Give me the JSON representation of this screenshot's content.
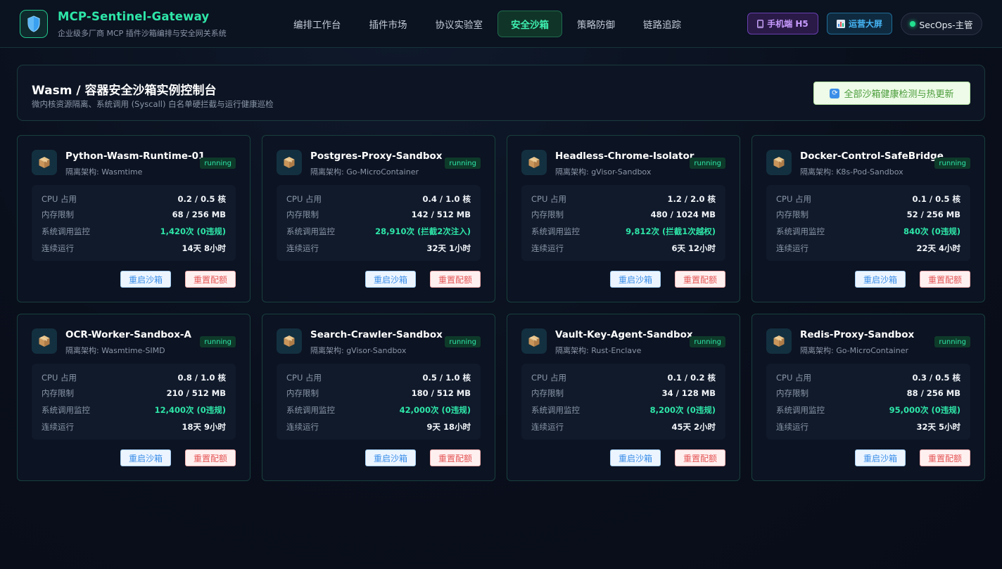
{
  "header": {
    "brand_title": "MCP-Sentinel-Gateway",
    "brand_subtitle": "企业级多厂商 MCP 插件沙箱编排与安全网关系统",
    "nav": [
      {
        "label": "编排工作台",
        "active": false
      },
      {
        "label": "插件市场",
        "active": false
      },
      {
        "label": "协议实验室",
        "active": false
      },
      {
        "label": "安全沙箱",
        "active": true
      },
      {
        "label": "策略防御",
        "active": false
      },
      {
        "label": "链路追踪",
        "active": false
      }
    ],
    "mobile_label": "手机端 H5",
    "screen_label": "运营大屏",
    "user_label": "SecOps-主管"
  },
  "panel": {
    "title": "Wasm / 容器安全沙箱实例控制台",
    "subtitle": "微内核资源隔离、系统调用 (Syscall) 白名单硬拦截与运行健康巡检",
    "health_button": "全部沙箱健康检测与热更新"
  },
  "labels": {
    "arch_prefix": "隔离架构: ",
    "cpu": "CPU 占用",
    "memory": "内存限制",
    "syscall": "系统调用监控",
    "uptime": "连续运行",
    "restart": "重启沙箱",
    "reset": "重置配额"
  },
  "colors": {
    "accent": "#2ee6a8",
    "status_running": "#2ee6a8",
    "restart_button": "#3a8ee8",
    "reset_button": "#e55555"
  },
  "sandboxes": [
    {
      "name": "Python-Wasm-Runtime-01",
      "arch": "隔离架构: Wasmtime",
      "status": "running",
      "cpu": "0.2 / 0.5 核",
      "memory": "68 / 256 MB",
      "syscall": "1,420次 (0违规)",
      "uptime": "14天 8小时"
    },
    {
      "name": "Postgres-Proxy-Sandbox",
      "arch": "隔离架构: Go-MicroContainer",
      "status": "running",
      "cpu": "0.4 / 1.0 核",
      "memory": "142 / 512 MB",
      "syscall": "28,910次 (拦截2次注入)",
      "uptime": "32天 1小时"
    },
    {
      "name": "Headless-Chrome-Isolator",
      "arch": "隔离架构: gVisor-Sandbox",
      "status": "running",
      "cpu": "1.2 / 2.0 核",
      "memory": "480 / 1024 MB",
      "syscall": "9,812次 (拦截1次越权)",
      "uptime": "6天 12小时"
    },
    {
      "name": "Docker-Control-SafeBridge",
      "arch": "隔离架构: K8s-Pod-Sandbox",
      "status": "running",
      "cpu": "0.1 / 0.5 核",
      "memory": "52 / 256 MB",
      "syscall": "840次 (0违规)",
      "uptime": "22天 4小时"
    },
    {
      "name": "OCR-Worker-Sandbox-A",
      "arch": "隔离架构: Wasmtime-SIMD",
      "status": "running",
      "cpu": "0.8 / 1.0 核",
      "memory": "210 / 512 MB",
      "syscall": "12,400次 (0违规)",
      "uptime": "18天 9小时"
    },
    {
      "name": "Search-Crawler-Sandbox",
      "arch": "隔离架构: gVisor-Sandbox",
      "status": "running",
      "cpu": "0.5 / 1.0 核",
      "memory": "180 / 512 MB",
      "syscall": "42,000次 (0违规)",
      "uptime": "9天 18小时"
    },
    {
      "name": "Vault-Key-Agent-Sandbox",
      "arch": "隔离架构: Rust-Enclave",
      "status": "running",
      "cpu": "0.1 / 0.2 核",
      "memory": "34 / 128 MB",
      "syscall": "8,200次 (0违规)",
      "uptime": "45天 2小时"
    },
    {
      "name": "Redis-Proxy-Sandbox",
      "arch": "隔离架构: Go-MicroContainer",
      "status": "running",
      "cpu": "0.3 / 0.5 核",
      "memory": "88 / 256 MB",
      "syscall": "95,000次 (0违规)",
      "uptime": "32天 5小时"
    }
  ]
}
